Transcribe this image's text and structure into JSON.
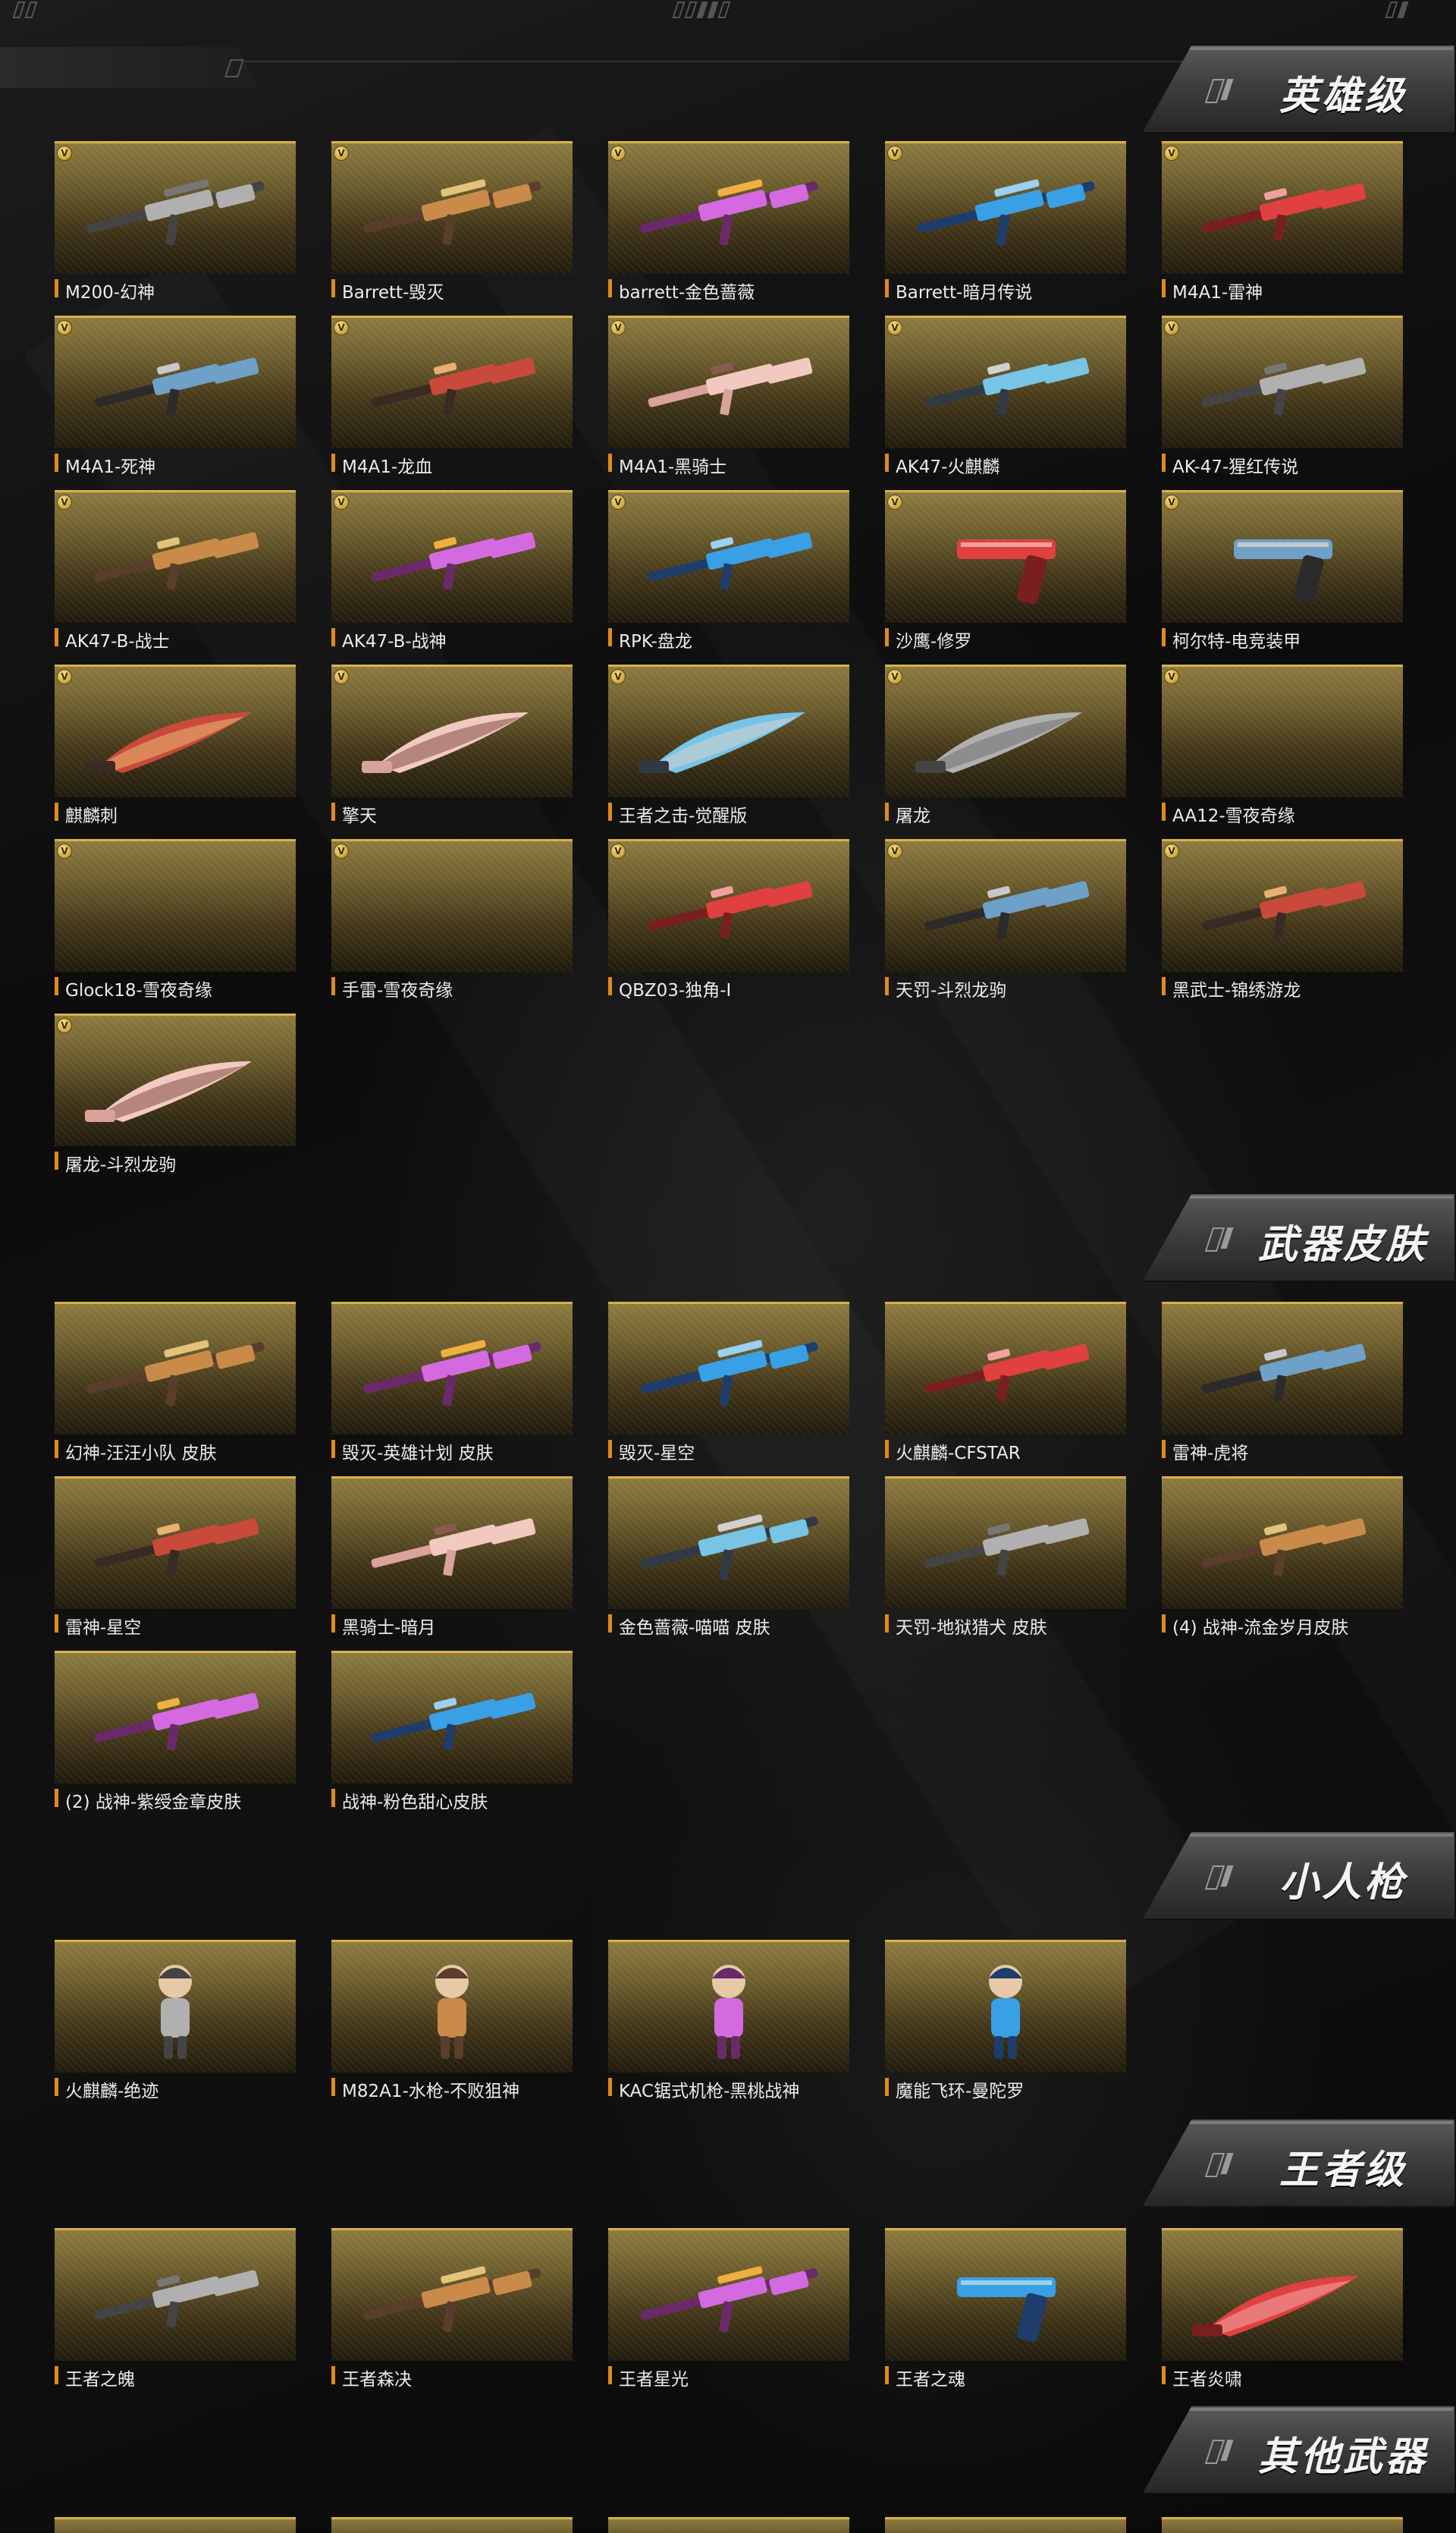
{
  "sections": {
    "hero": {
      "title": "英雄级",
      "items": [
        {
          "name": "M200-幻神",
          "icon": "sniper-rifle-icon"
        },
        {
          "name": "Barrett-毁灭",
          "icon": "sniper-rifle-icon"
        },
        {
          "name": "barrett-金色蔷薇",
          "icon": "sniper-rifle-icon"
        },
        {
          "name": "Barrett-暗月传说",
          "icon": "sniper-rifle-icon"
        },
        {
          "name": "M4A1-雷神",
          "icon": "assault-rifle-icon"
        },
        {
          "name": "M4A1-死神",
          "icon": "assault-rifle-icon"
        },
        {
          "name": "M4A1-龙血",
          "icon": "assault-rifle-icon"
        },
        {
          "name": "M4A1-黑骑士",
          "icon": "assault-rifle-icon"
        },
        {
          "name": "AK47-火麒麟",
          "icon": "assault-rifle-icon"
        },
        {
          "name": "AK-47-猩红传说",
          "icon": "assault-rifle-icon"
        },
        {
          "name": "AK47-B-战士",
          "icon": "assault-rifle-icon"
        },
        {
          "name": "AK47-B-战神",
          "icon": "assault-rifle-icon"
        },
        {
          "name": "RPK-盘龙",
          "icon": "machine-gun-icon"
        },
        {
          "name": "沙鹰-修罗",
          "icon": "pistol-icon"
        },
        {
          "name": "柯尔特-电竞装甲",
          "icon": "pistol-icon"
        },
        {
          "name": "麒麟刺",
          "icon": "melee-icon"
        },
        {
          "name": "擎天",
          "icon": "melee-icon"
        },
        {
          "name": "王者之击-觉醒版",
          "icon": "melee-icon"
        },
        {
          "name": "屠龙",
          "icon": "melee-icon"
        },
        {
          "name": "AA12-雪夜奇缘",
          "icon": "empty-icon"
        },
        {
          "name": "Glock18-雪夜奇缘",
          "icon": "empty-icon"
        },
        {
          "name": "手雷-雪夜奇缘",
          "icon": "empty-icon"
        },
        {
          "name": "QBZ03-独角-I",
          "icon": "assault-rifle-icon"
        },
        {
          "name": "天罚-斗烈龙驹",
          "icon": "assault-rifle-icon"
        },
        {
          "name": "黑武士-锦绣游龙",
          "icon": "assault-rifle-icon"
        },
        {
          "name": "屠龙-斗烈龙驹",
          "icon": "melee-icon"
        }
      ]
    },
    "skins": {
      "title": "武器皮肤",
      "items": [
        {
          "name": "幻神-汪汪小队 皮肤",
          "icon": "sniper-rifle-icon"
        },
        {
          "name": "毁灭-英雄计划 皮肤",
          "icon": "sniper-rifle-icon"
        },
        {
          "name": "毁灭-星空",
          "icon": "sniper-rifle-icon"
        },
        {
          "name": "火麒麟-CFSTAR",
          "icon": "assault-rifle-icon"
        },
        {
          "name": "雷神-虎将",
          "icon": "assault-rifle-icon"
        },
        {
          "name": "雷神-星空",
          "icon": "assault-rifle-icon"
        },
        {
          "name": "黑骑士-暗月",
          "icon": "assault-rifle-icon"
        },
        {
          "name": "金色蔷薇-喵喵 皮肤",
          "icon": "sniper-rifle-icon"
        },
        {
          "name": "天罚-地狱猎犬 皮肤",
          "icon": "assault-rifle-icon"
        },
        {
          "name": "(4) 战神-流金岁月皮肤",
          "icon": "assault-rifle-icon"
        },
        {
          "name": "(2) 战神-紫绶金章皮肤",
          "icon": "assault-rifle-icon"
        },
        {
          "name": "战神-粉色甜心皮肤",
          "icon": "assault-rifle-icon"
        }
      ]
    },
    "mini": {
      "title": "小人枪",
      "items": [
        {
          "name": "火麒麟-绝迹",
          "icon": "figure-icon"
        },
        {
          "name": "M82A1-水枪-不败狙神",
          "icon": "figure-icon"
        },
        {
          "name": "KAC锯式机枪-黑桃战神",
          "icon": "figure-icon"
        },
        {
          "name": "魔能飞环-曼陀罗",
          "icon": "figure-icon"
        }
      ]
    },
    "king": {
      "title": "王者级",
      "items": [
        {
          "name": "王者之魄",
          "icon": "assault-rifle-icon"
        },
        {
          "name": "王者森决",
          "icon": "sniper-rifle-icon"
        },
        {
          "name": "王者星光",
          "icon": "sniper-rifle-icon"
        },
        {
          "name": "王者之魂",
          "icon": "pistol-icon"
        },
        {
          "name": "王者炎啸",
          "icon": "melee-icon"
        }
      ]
    },
    "other": {
      "title": "其他武器",
      "items": []
    }
  },
  "colors": {
    "card_gold": "#8d7a3f",
    "card_border": "#d8b24a",
    "label_accent": "#e08a1b",
    "header_text": "#f4f4f4"
  }
}
